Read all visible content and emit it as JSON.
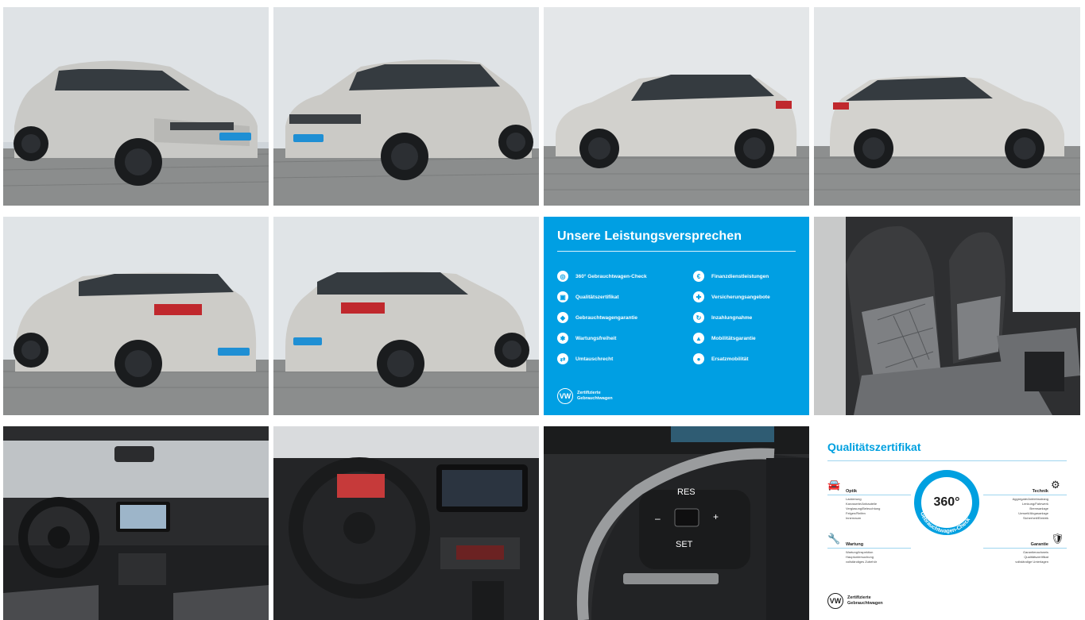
{
  "gallery": {
    "photos": [
      {
        "alt": "front-left-exterior"
      },
      {
        "alt": "front-right-exterior"
      },
      {
        "alt": "left-side-exterior"
      },
      {
        "alt": "right-side-exterior"
      },
      {
        "alt": "rear-left-exterior"
      },
      {
        "alt": "rear-right-exterior"
      },
      {
        "alt": "front-seats-interior"
      },
      {
        "alt": "dashboard-interior"
      },
      {
        "alt": "cockpit-interior"
      },
      {
        "alt": "steering-wheel-buttons"
      }
    ],
    "steering_buttons": {
      "res": "RES",
      "set": "SET",
      "minus": "–",
      "plus": "+"
    }
  },
  "promise_card": {
    "title": "Unsere Leistungsversprechen",
    "left_items": [
      "360° Gebrauchtwagen-Check",
      "Qualitätszertifikat",
      "Gebrauchtwagengarantie",
      "Wartungsfreiheit",
      "Umtauschrecht"
    ],
    "right_items": [
      "Finanzdienstleistungen",
      "Versicherungsangebote",
      "Inzahlungnahme",
      "Mobilitätsgarantie",
      "Ersatzmobilität"
    ],
    "brand_line1": "Zertifizierte",
    "brand_line2": "Gebrauchtwagen",
    "logo": "VW",
    "accent": "#009fe3"
  },
  "cert_card": {
    "title": "Qualitätszertifikat",
    "badge_value": "360°",
    "badge_ring": "Gebrauchtwagen-Check",
    "optik": {
      "title": "Optik",
      "items": [
        "Lackierung",
        "Karosserie/Anbauteile",
        "Verglasung/Beleuchtung",
        "Felgen/Reifen",
        "Innenraum"
      ]
    },
    "wartung": {
      "title": "Wartung",
      "items": [
        "Wartung/Inspektion",
        "Hauptuntersuchung",
        "vollständiges Zubehör"
      ]
    },
    "technik": {
      "title": "Technik",
      "items": [
        "Aggregate/Antriebsstrang",
        "Lenkung/Fahrwerk",
        "Bremsanlage",
        "Umwelt/Abgasanlage",
        "Sicherheit/Elektrik"
      ]
    },
    "garantie": {
      "title": "Garantie",
      "items": [
        "Garantienachweis",
        "Qualitätszertifikat",
        "vollständige Unterlagen"
      ]
    },
    "brand_line1": "Zertifizierte",
    "brand_line2": "Gebrauchtwagen",
    "logo": "VW",
    "accent": "#00a0e0"
  }
}
